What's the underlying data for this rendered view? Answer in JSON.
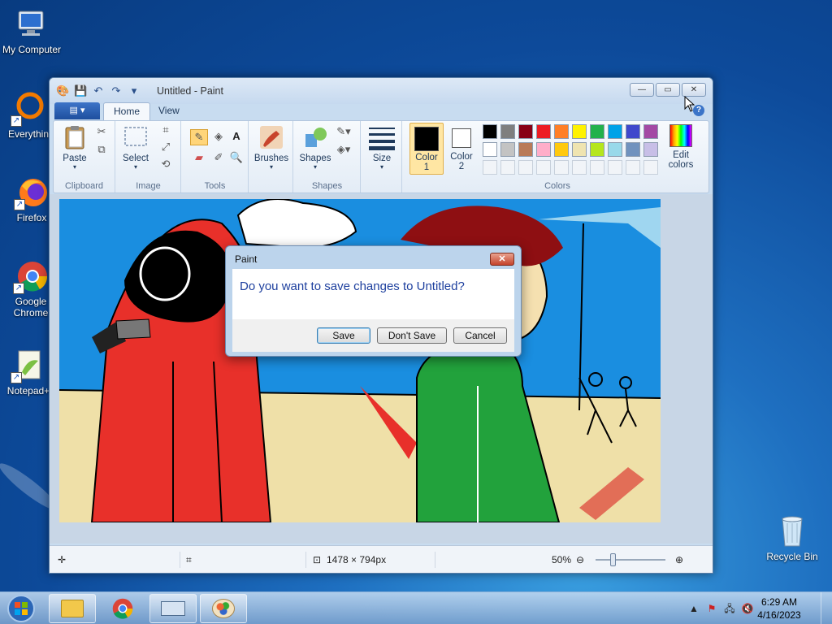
{
  "desktop": {
    "icons": [
      {
        "label": "My Computer",
        "icon": "computer-icon"
      },
      {
        "label": "Everythin",
        "icon": "everything-search-icon"
      },
      {
        "label": "Firefox",
        "icon": "firefox-icon"
      },
      {
        "label": "Google Chrome",
        "icon": "chrome-icon"
      },
      {
        "label": "Notepad+",
        "icon": "notepadplusplus-icon"
      },
      {
        "label": "Recycle Bin",
        "icon": "recycle-bin-icon"
      }
    ]
  },
  "window": {
    "title": "Untitled - Paint",
    "tabs": [
      "Home",
      "View"
    ],
    "active_tab": "Home",
    "controls": {
      "minimize": "—",
      "maximize": "▭",
      "close": "✕"
    }
  },
  "ribbon": {
    "clipboard": {
      "label": "Clipboard",
      "paste": "Paste"
    },
    "image": {
      "label": "Image",
      "select": "Select"
    },
    "tools": {
      "label": "Tools"
    },
    "brushes": {
      "label": "Brushes"
    },
    "shapes": {
      "label": "Shapes",
      "shapes_btn": "Shapes"
    },
    "size": {
      "label": "Size"
    },
    "colors": {
      "label": "Colors",
      "color1": "Color 1",
      "color1_line2": "1",
      "color1_name": "Color",
      "color2_name": "Color",
      "color2_line2": "2",
      "edit_colors_line1": "Edit",
      "edit_colors_line2": "colors",
      "color1_value": "#000000",
      "color2_value": "#ffffff",
      "palette_row1": [
        "#000000",
        "#7f7f7f",
        "#880015",
        "#ed1c24",
        "#ff7f27",
        "#fff200",
        "#22b14c",
        "#00a2e8",
        "#3f48cc",
        "#a349a4"
      ],
      "palette_row2": [
        "#ffffff",
        "#c3c3c3",
        "#b97a57",
        "#ffaec9",
        "#ffc90e",
        "#efe4b0",
        "#b5e61d",
        "#99d9ea",
        "#7092be",
        "#c8bfe7"
      ]
    }
  },
  "statusbar": {
    "dimensions": "1478 × 794px",
    "zoom": "50%"
  },
  "dialog": {
    "title": "Paint",
    "message": "Do you want to save changes to Untitled?",
    "buttons": {
      "save": "Save",
      "dont_save": "Don't Save",
      "cancel": "Cancel"
    }
  },
  "taskbar": {
    "time": "6:29 AM",
    "date": "4/16/2023"
  }
}
